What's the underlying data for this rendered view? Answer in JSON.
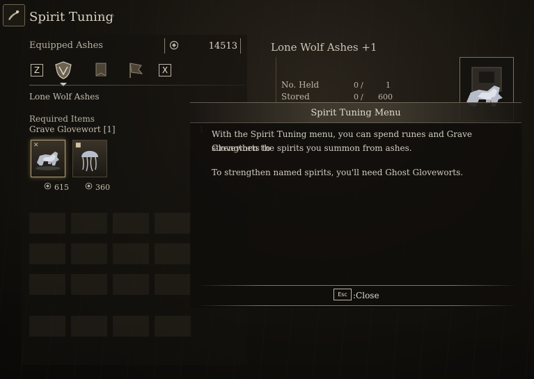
{
  "header": {
    "title": "Spirit Tuning",
    "icon": "spirit-tuning-emblem-icon"
  },
  "equipped": {
    "label": "Equipped Ashes",
    "runes": "14513",
    "rune_icon": "rune-icon"
  },
  "tabs": [
    {
      "key": "Z"
    },
    {
      "icon": "shield-icon",
      "active": true
    },
    {
      "icon": "banner-icon"
    },
    {
      "icon": "flag-icon"
    },
    {
      "key": "X"
    }
  ],
  "left": {
    "ash_name": "Lone Wolf Ashes",
    "required_label": "Required Items",
    "required_item": "Grave Glovewort [1]",
    "required_count": "1",
    "slots": [
      {
        "name": "wolf-ashes",
        "cost": "615",
        "selected": true
      },
      {
        "name": "jellyfish-ashes",
        "cost": "360",
        "selected": false
      }
    ]
  },
  "info": {
    "title": "Lone Wolf Ashes +1",
    "stats": [
      {
        "label": "No. Held",
        "a": "0",
        "b": "1"
      },
      {
        "label": "Stored",
        "a": "0",
        "b": "600"
      }
    ]
  },
  "modal": {
    "title": "Spirit Tuning Menu",
    "line1": "With the Spirit Tuning menu, you can spend runes and Grave Gloveworts to",
    "line2": "strengthen the spirits you summon from ashes.",
    "line3": "To strengthen named spirits, you'll need Ghost Gloveworts.",
    "esc_key": "Esc",
    "close_label": ":Close"
  }
}
